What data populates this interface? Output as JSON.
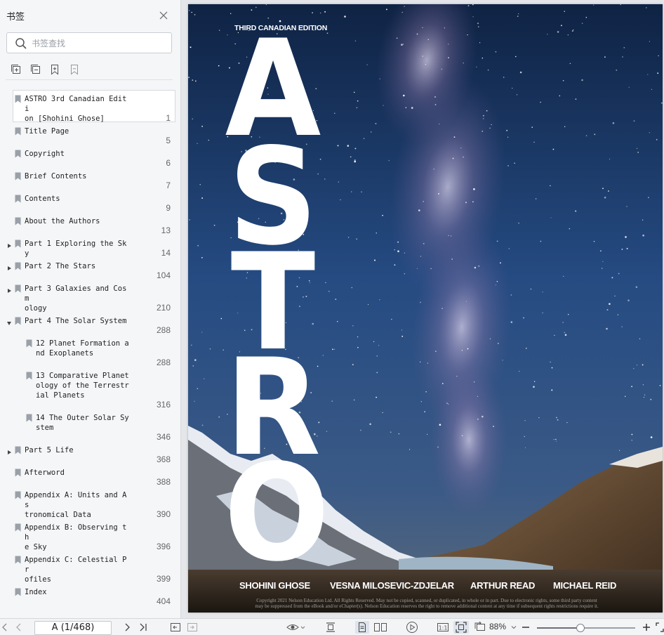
{
  "sidebar": {
    "title": "书签",
    "search_placeholder": "书签查找",
    "bookmarks": [
      {
        "label": "ASTRO 3rd Canadian Editi\non [Shohini Ghose]",
        "page": "1",
        "level": 0,
        "expand": "none",
        "selected": true
      },
      {
        "label": "Title Page",
        "page": "5",
        "level": 0,
        "expand": "none"
      },
      {
        "label": "Copyright",
        "page": "6",
        "level": 0,
        "expand": "none"
      },
      {
        "label": "Brief Contents",
        "page": "7",
        "level": 0,
        "expand": "none"
      },
      {
        "label": "Contents",
        "page": "9",
        "level": 0,
        "expand": "none"
      },
      {
        "label": "About the Authors",
        "page": "13",
        "level": 0,
        "expand": "none"
      },
      {
        "label": "Part 1 Exploring the Sky",
        "page": "14",
        "level": 0,
        "expand": "collapsed"
      },
      {
        "label": "Part 2 The Stars",
        "page": "104",
        "level": 0,
        "expand": "collapsed"
      },
      {
        "label": "Part 3 Galaxies and Cosm\nology",
        "page": "210",
        "level": 0,
        "expand": "collapsed"
      },
      {
        "label": "Part 4 The Solar System",
        "page": "288",
        "level": 0,
        "expand": "expanded"
      },
      {
        "label": "12 Planet Formation a\nnd Exoplanets",
        "page": "288",
        "level": 1,
        "expand": "none"
      },
      {
        "label": "13 Comparative Planet\nology of the Terrestr\nial Planets",
        "page": "316",
        "level": 1,
        "expand": "none"
      },
      {
        "label": "14 The Outer Solar Sy\nstem",
        "page": "346",
        "level": 1,
        "expand": "none"
      },
      {
        "label": "Part 5 Life",
        "page": "368",
        "level": 0,
        "expand": "collapsed"
      },
      {
        "label": "Afterword",
        "page": "388",
        "level": 0,
        "expand": "none"
      },
      {
        "label": "Appendix A: Units and As\ntronomical Data",
        "page": "390",
        "level": 0,
        "expand": "none"
      },
      {
        "label": "Appendix B: Observing th\ne Sky",
        "page": "396",
        "level": 0,
        "expand": "none"
      },
      {
        "label": "Appendix C: Celestial Pr\nofiles",
        "page": "399",
        "level": 0,
        "expand": "none"
      },
      {
        "label": "Index",
        "page": "404",
        "level": 0,
        "expand": "none"
      }
    ]
  },
  "cover": {
    "edition": "THIRD CANADIAN EDITION",
    "letters": [
      "A",
      "S",
      "T",
      "R",
      "O"
    ],
    "authors": [
      "SHOHINI GHOSE",
      "VESNA MILOSEVIC-ZDJELAR",
      "ARTHUR READ",
      "MICHAEL REID"
    ],
    "copyright_line1": "Copyright 2021 Nelson Education Ltd. All Rights Reserved. May not be copied, scanned, or duplicated, in whole or in part. Due to electronic rights, some third party content",
    "copyright_line2": "may be suppressed from the eBook and/or eChapter(s). Nelson Education reserves the right to remove additional content at any time if subsequent rights restrictions require it."
  },
  "statusbar": {
    "page_indicator": "A (1/468)",
    "zoom": "88%",
    "zoom_fraction": 0.44
  },
  "colors": {
    "sidebar_bg": "#f5f6f8",
    "accent": "#3c78d8",
    "sky_top": "#13294f",
    "sky_mid": "#2a4f86"
  }
}
